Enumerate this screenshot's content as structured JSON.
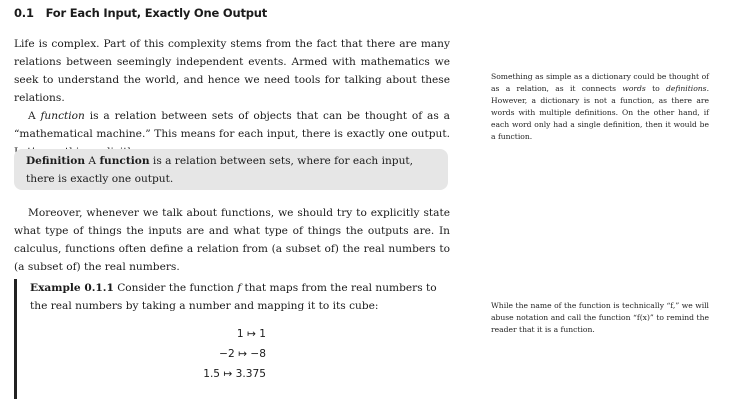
{
  "section": {
    "number": "0.1",
    "title": "For Each Input, Exactly One Output"
  },
  "intro": {
    "para1": "Life is complex. Part of this complexity stems from the fact that there are many relations between seemingly independent events. Armed with mathematics we seek to understand the world, and hence we need tools for talking about these relations.",
    "para2_before": "A ",
    "para2_term": "function",
    "para2_after": " is a relation between sets of objects that can be thought of as a “mathematical machine.” This means for each input, there is exactly one output. Let’s say this explicitly."
  },
  "definition": {
    "label": "Definition",
    "term": "function",
    "text_before": "A ",
    "text_after": " is a relation between sets, where for each input, there is exactly one output."
  },
  "para3": "Moreover, whenever we talk about functions, we should try to explicitly state what type of things the inputs are and what type of things the outputs are. In calculus, functions often define a relation from (a subset of) the real numbers to (a subset of) the real numbers.",
  "example": {
    "label": "Example 0.1.1",
    "text_before": "Consider the function ",
    "func": "f",
    "text_after": " that maps from the real numbers to the real numbers by taking a number and mapping it to its cube:",
    "mappings": [
      "1 ↦ 1",
      "−2 ↦ −8",
      "1.5 ↦ 3.375"
    ]
  },
  "sidenotes": {
    "dictionary_before": "Something as simple as a dictionary could be thought of as a relation, as it connects ",
    "dictionary_words": "words",
    "dictionary_mid": " to ",
    "dictionary_defs": "definitions",
    "dictionary_after": ". However, a dictionary is not a function, as there are words with multiple definitions. On the other hand, if each word only had a single definition, then it would be a function.",
    "notation": "While the name of the function is technically “f,” we will abuse notation and call the function “f(x)” to remind the reader that it is a function."
  }
}
